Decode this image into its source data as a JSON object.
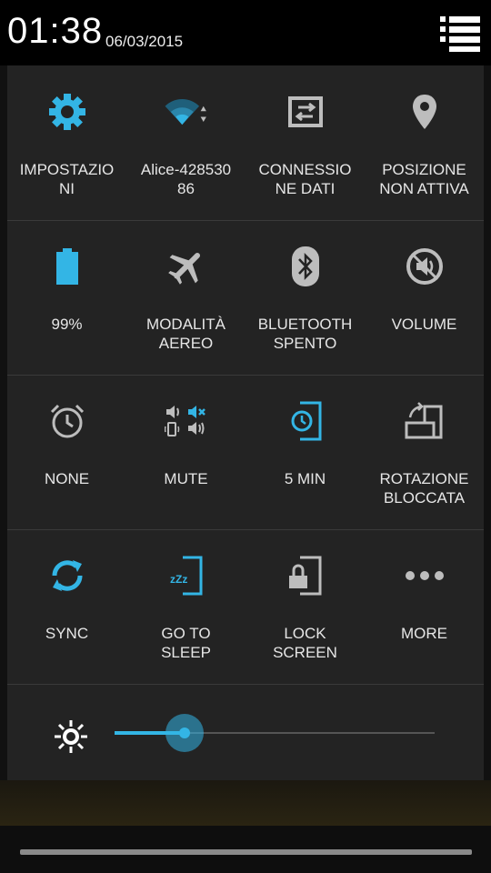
{
  "status": {
    "time": "01:38",
    "date": "06/03/2015"
  },
  "colors": {
    "accent": "#33b5e5",
    "icon_gray": "#bdbdbd"
  },
  "tiles": [
    {
      "label": "IMPOSTAZIO\nNI",
      "icon": "settings-gear-icon"
    },
    {
      "label": "Alice-428530\n86",
      "icon": "wifi-icon"
    },
    {
      "label": "CONNESSIO\nNE DATI",
      "icon": "data-connection-icon"
    },
    {
      "label": "POSIZIONE\nNON ATTIVA",
      "icon": "location-pin-icon"
    },
    {
      "label": "99%",
      "icon": "battery-icon"
    },
    {
      "label": "MODALITÀ\nAEREO",
      "icon": "airplane-icon"
    },
    {
      "label": "BLUETOOTH\nSPENTO",
      "icon": "bluetooth-icon"
    },
    {
      "label": "VOLUME",
      "icon": "volume-icon"
    },
    {
      "label": "NONE",
      "icon": "alarm-clock-icon"
    },
    {
      "label": "MUTE",
      "icon": "sound-mode-icon"
    },
    {
      "label": "5 MIN",
      "icon": "screen-timeout-icon"
    },
    {
      "label": "ROTAZIONE\nBLOCCATA",
      "icon": "rotation-lock-icon"
    },
    {
      "label": "SYNC",
      "icon": "sync-icon"
    },
    {
      "label": "GO TO\nSLEEP",
      "icon": "sleep-icon"
    },
    {
      "label": "LOCK\nSCREEN",
      "icon": "lock-screen-icon"
    },
    {
      "label": "MORE",
      "icon": "more-icon"
    }
  ],
  "brightness": {
    "level": 0.22
  }
}
